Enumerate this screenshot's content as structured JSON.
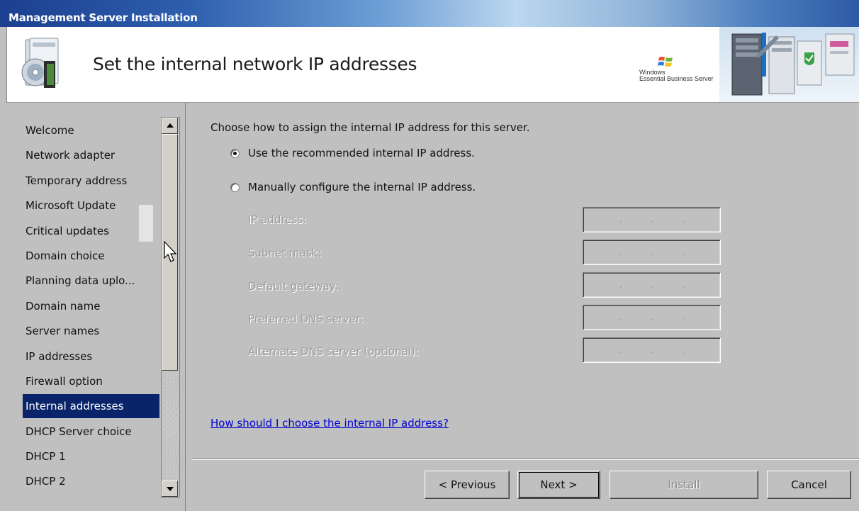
{
  "window": {
    "title": "Management Server Installation"
  },
  "header": {
    "title": "Set the internal network IP addresses",
    "brand_line1": "Windows",
    "brand_line2": "Essential Business Server"
  },
  "nav": {
    "items": [
      {
        "label": "Welcome"
      },
      {
        "label": "Network adapter"
      },
      {
        "label": "Temporary address"
      },
      {
        "label": "Microsoft Update"
      },
      {
        "label": "Critical updates"
      },
      {
        "label": "Domain choice"
      },
      {
        "label": "Planning data uplo..."
      },
      {
        "label": "Domain name"
      },
      {
        "label": "Server names"
      },
      {
        "label": "IP addresses"
      },
      {
        "label": "Firewall option"
      },
      {
        "label": "Internal addresses",
        "selected": true
      },
      {
        "label": "DHCP Server choice"
      },
      {
        "label": "DHCP 1"
      },
      {
        "label": "DHCP 2"
      }
    ]
  },
  "main": {
    "prompt": "Choose how to assign the internal IP address for this server.",
    "option_recommended": "Use the recommended internal IP address.",
    "option_manual": "Manually configure the internal IP address.",
    "selected_option": "recommended",
    "fields": [
      {
        "label": "IP address:",
        "value": ""
      },
      {
        "label": "Subnet mask:",
        "value": ""
      },
      {
        "label": "Default gateway:",
        "value": ""
      },
      {
        "label": "Preferred DNS server:",
        "value": ""
      },
      {
        "label": "Alternate DNS server (optional):",
        "value": ""
      }
    ],
    "help_link": "How should I choose the internal IP address?"
  },
  "buttons": {
    "previous": "< Previous",
    "next": "Next >",
    "install": "Install",
    "cancel": "Cancel"
  }
}
